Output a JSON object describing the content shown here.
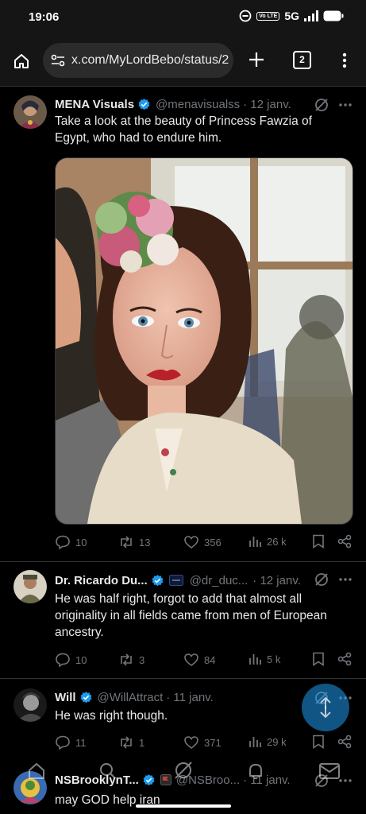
{
  "status_bar": {
    "time": "19:06",
    "volte": "Vo LTE",
    "network": "5G"
  },
  "browser": {
    "url": "x.com/MyLordBebo/status/2",
    "tab_count": "2"
  },
  "tweets": [
    {
      "name": "MENA Visuals",
      "handle": "@menavisualss",
      "date": "· 12 janv.",
      "text": "Take a look at the beauty of Princess Fawzia of Egypt, who had to endure him.",
      "replies": "10",
      "reposts": "13",
      "likes": "356",
      "views": "26 k"
    },
    {
      "name": "Dr. Ricardo Du...",
      "handle": "@dr_duc...",
      "date": "· 12 janv.",
      "text": "He was half right, forgot to add that almost all originality in all fields came from men of European ancestry.",
      "replies": "10",
      "reposts": "3",
      "likes": "84",
      "views": "5 k"
    },
    {
      "name": "Will",
      "handle": "@WillAttract",
      "date": "· 11 janv.",
      "text": "He was right though.",
      "replies": "11",
      "reposts": "1",
      "likes": "371",
      "views": "29 k"
    },
    {
      "name": "NSBrooklynT...",
      "handle": "@NSBroo...",
      "date": "· 11 janv.",
      "text": "may GOD help iran"
    }
  ],
  "colors": {
    "verified": "#1d9bf0",
    "muted": "#71767b",
    "background": "#000000"
  }
}
